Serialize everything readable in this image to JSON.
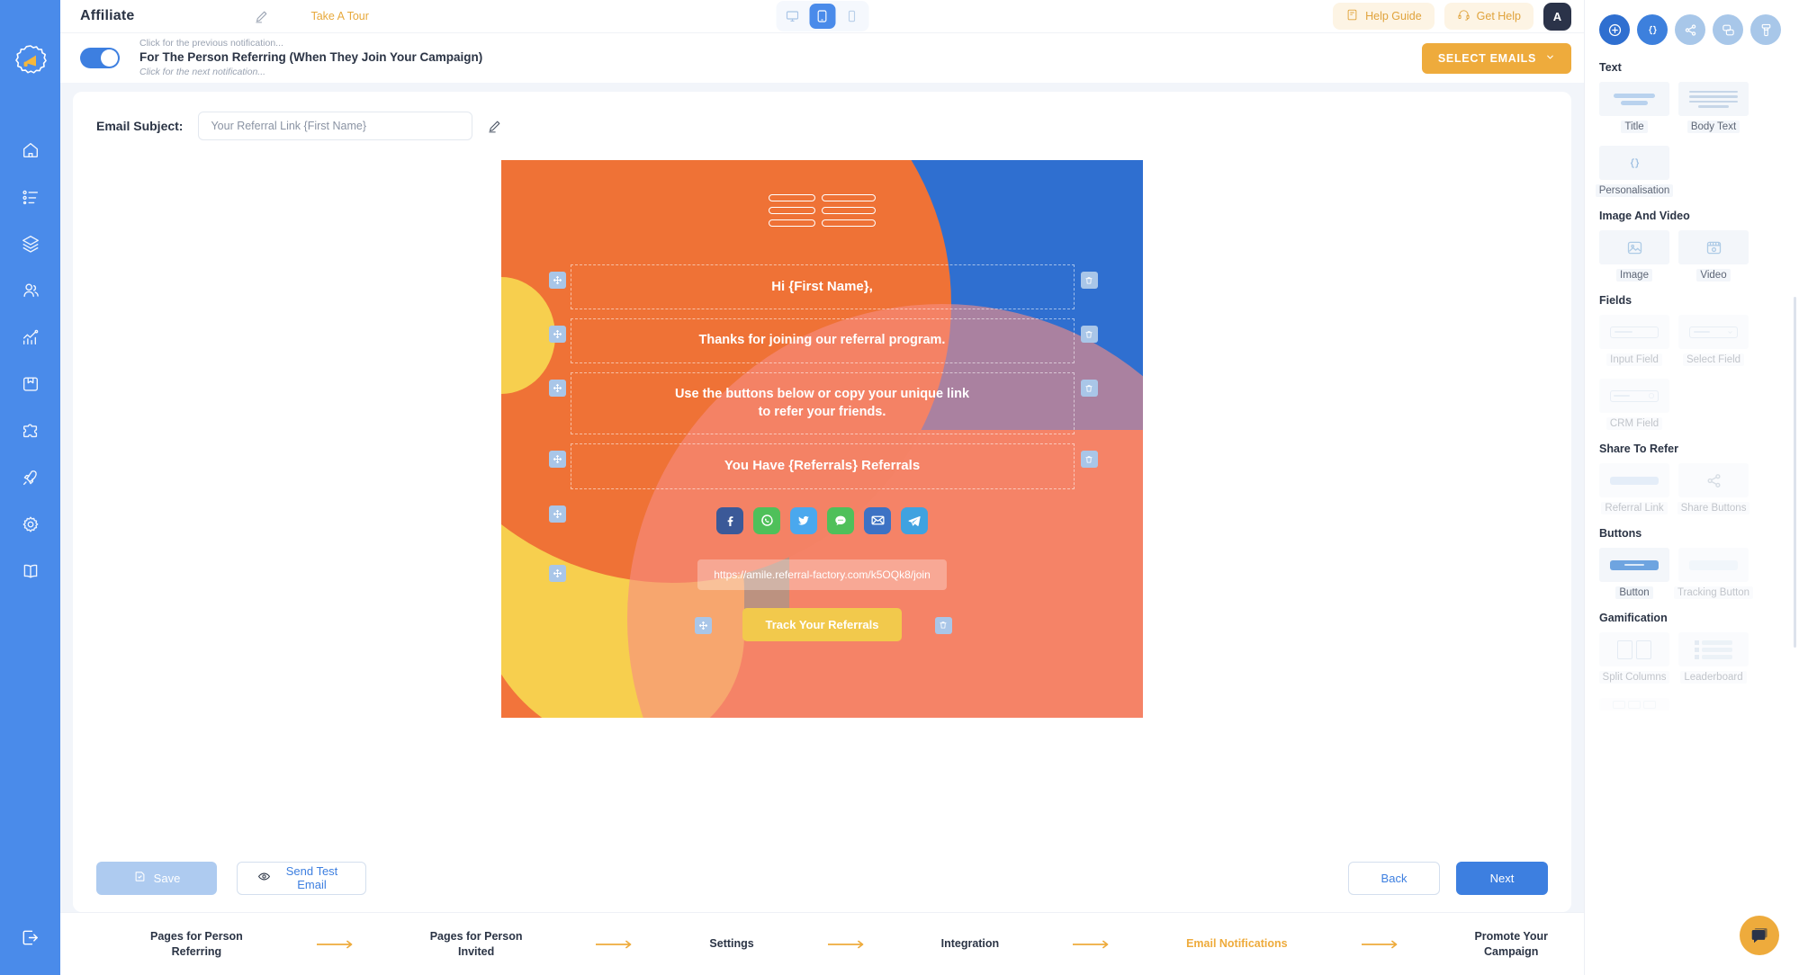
{
  "rail": {
    "logo_icon": "megaphone-logo-icon",
    "items": [
      {
        "name": "home-icon",
        "label": "Home"
      },
      {
        "name": "list-icon",
        "label": "Campaigns"
      },
      {
        "name": "layers-icon",
        "label": "Templates"
      },
      {
        "name": "users-icon",
        "label": "Users"
      },
      {
        "name": "analytics-icon",
        "label": "Analytics"
      },
      {
        "name": "archive-icon",
        "label": "Archive"
      },
      {
        "name": "puzzle-icon",
        "label": "Integrations"
      },
      {
        "name": "rocket-icon",
        "label": "Launch"
      },
      {
        "name": "gear-icon",
        "label": "Settings"
      },
      {
        "name": "book-icon",
        "label": "Docs"
      }
    ],
    "logout_icon": "logout-icon"
  },
  "topbar": {
    "title": "Affiliate",
    "edit_icon": "pencil-icon",
    "take_tour": "Take A Tour",
    "devices": [
      {
        "name": "desktop-icon",
        "active": false
      },
      {
        "name": "tablet-icon",
        "active": true
      },
      {
        "name": "mobile-icon",
        "active": false
      }
    ],
    "help_guide": "Help Guide",
    "help_guide_icon": "book-icon",
    "get_help": "Get Help",
    "get_help_icon": "headset-icon",
    "avatar_initial": "A"
  },
  "notification": {
    "toggle_on": true,
    "previous_hint": "Click for the previous notification...",
    "title": "For The Person Referring (When They Join Your Campaign)",
    "next_hint": "Click for the next notification...",
    "select_emails_label": "SELECT EMAILS",
    "select_emails_chevron": "chevron-down-icon"
  },
  "subject": {
    "label": "Email Subject:",
    "value": "Your Referral Link {First Name}",
    "placeholder": "Your Referral Link {First Name}",
    "edit_icon": "pencil-icon"
  },
  "email_preview": {
    "logo_name": "email-brand-logo",
    "blocks": [
      {
        "id": "greeting",
        "text": "Hi {First Name},",
        "size": "big"
      },
      {
        "id": "intro",
        "text": "Thanks for joining our referral program.",
        "size": "normal"
      },
      {
        "id": "instructions",
        "text": "Use the buttons below or copy your unique link to refer your friends.",
        "size": "normal"
      },
      {
        "id": "referral-count",
        "text": "You Have {Referrals} Referrals",
        "size": "big"
      }
    ],
    "social_buttons": [
      {
        "name": "facebook-icon",
        "color": "#3b5998"
      },
      {
        "name": "whatsapp-icon",
        "color": "#4fc05a"
      },
      {
        "name": "twitter-icon",
        "color": "#4aa8ee"
      },
      {
        "name": "sms-icon",
        "color": "#4fc05a"
      },
      {
        "name": "email-icon",
        "color": "#3d72c4"
      },
      {
        "name": "telegram-icon",
        "color": "#3fa2e0"
      }
    ],
    "referral_link": "https://amile.referral-factory.com/k5OQk8/join",
    "cta_label": "Track Your Referrals",
    "handle_move_icon": "move-handle-icon",
    "handle_delete_icon": "trash-icon"
  },
  "footer": {
    "save_label": "Save",
    "save_icon": "save-icon",
    "save_disabled": true,
    "test_label": "Send Test Email",
    "test_icon": "eye-icon",
    "back_label": "Back",
    "next_label": "Next"
  },
  "stepper": {
    "steps": [
      {
        "label": "Pages for Person Referring",
        "line1": "Pages for Person",
        "line2": "Referring",
        "active": false
      },
      {
        "label": "Pages for Person Invited",
        "line1": "Pages for Person",
        "line2": "Invited",
        "active": false
      },
      {
        "label": "Settings",
        "line1": "Settings",
        "line2": "",
        "active": false
      },
      {
        "label": "Integration",
        "line1": "Integration",
        "line2": "",
        "active": false
      },
      {
        "label": "Email Notifications",
        "line1": "Email Notifications",
        "line2": "",
        "active": true
      },
      {
        "label": "Promote Your Campaign",
        "line1": "Promote Your",
        "line2": "Campaign",
        "active": false
      }
    ],
    "arrow_icon": "arrow-right-icon"
  },
  "right_panel": {
    "tools": [
      {
        "name": "add-element-icon",
        "state": "active-dark"
      },
      {
        "name": "personalisation-braces-icon",
        "state": "active-mid"
      },
      {
        "name": "share-icon",
        "state": "idle"
      },
      {
        "name": "duplicate-icon",
        "state": "idle"
      },
      {
        "name": "paint-icon",
        "state": "idle"
      }
    ],
    "groups": [
      {
        "title": "Text",
        "items": [
          {
            "label": "Title",
            "icon": "title-icon",
            "disabled": false
          },
          {
            "label": "Body Text",
            "icon": "body-text-icon",
            "disabled": false
          },
          {
            "label": "Personalisation",
            "icon": "braces-icon",
            "disabled": false
          }
        ]
      },
      {
        "title": "Image And Video",
        "items": [
          {
            "label": "Image",
            "icon": "image-icon",
            "disabled": false
          },
          {
            "label": "Video",
            "icon": "video-icon",
            "disabled": false
          }
        ]
      },
      {
        "title": "Fields",
        "items": [
          {
            "label": "Input Field",
            "icon": "input-field-icon",
            "disabled": true
          },
          {
            "label": "Select Field",
            "icon": "select-field-icon",
            "disabled": true
          },
          {
            "label": "CRM Field",
            "icon": "crm-field-icon",
            "disabled": true
          }
        ]
      },
      {
        "title": "Share To Refer",
        "items": [
          {
            "label": "Referral Link",
            "icon": "referral-link-icon",
            "disabled": true
          },
          {
            "label": "Share Buttons",
            "icon": "share-buttons-icon",
            "disabled": true
          }
        ]
      },
      {
        "title": "Buttons",
        "items": [
          {
            "label": "Button",
            "icon": "button-icon",
            "disabled": false
          },
          {
            "label": "Tracking Button",
            "icon": "tracking-button-icon",
            "disabled": true
          }
        ]
      },
      {
        "title": "Gamification",
        "items": [
          {
            "label": "Split Columns",
            "icon": "split-columns-icon",
            "disabled": true
          },
          {
            "label": "Leaderboard",
            "icon": "leaderboard-icon",
            "disabled": true
          }
        ]
      }
    ]
  },
  "chat": {
    "icon": "chat-bubbles-icon"
  },
  "colors": {
    "brand_blue": "#4a8bea",
    "accent_orange": "#eeab3c",
    "next_blue": "#3d7fe0",
    "email_orange": "#ef7236",
    "email_pink": "#f78c82",
    "email_yellow": "#f7cf4e",
    "email_blue": "#2f6fd0",
    "cta_yellow": "#f2c94c"
  }
}
